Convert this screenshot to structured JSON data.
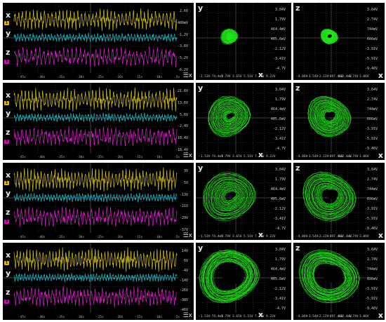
{
  "layout_rows": 4,
  "colors": {
    "x_trace": "#d8c400",
    "y_trace": "#1fb6c2",
    "z_trace": "#d11fc2",
    "phase": "#22e61a",
    "marker_x": "#e8b400",
    "marker_z": "#e000c8"
  },
  "rows": [
    {
      "time": {
        "labels": {
          "x": "x",
          "y": "y",
          "z": "z"
        },
        "ticks": [
          "-45s",
          "-40s",
          "-35s",
          "-30s",
          "-25s",
          "-20s",
          "-15s",
          "-10s",
          "-5s"
        ],
        "scale": [
          "2.6V",
          "400mV",
          "-1.2V",
          "-3.6V",
          "-5.2V",
          "-6.2V"
        ],
        "zoom": "☰x"
      },
      "xy": {
        "axis_x": "x",
        "axis_y": "y",
        "yticks": [
          "3.04V",
          "1.79V",
          "464.4mV",
          "405.6mV",
          "-2.12V",
          "-3.41V",
          "-4.7V"
        ],
        "xticks": [
          "-1.53V",
          "-74.4mV",
          "1.79V",
          "3.65V",
          "5.51V",
          "7.37V",
          "9.22V"
        ],
        "size": 0.12,
        "hole": 0.0
      },
      "xz": {
        "axis_x": "x",
        "axis_y": "z",
        "yticks": [
          "3.64V",
          "2.74V",
          "744mV",
          "606mV",
          "-3.91V",
          "-5.91V",
          "-9.46V"
        ],
        "xticks": [
          "-4.86V",
          "-3.54V",
          "-2.22V",
          "-897.4mV",
          "422.4mV",
          "1.74V",
          "3.06V"
        ],
        "size": 0.12,
        "hole": 0.25
      }
    },
    {
      "time": {
        "labels": {
          "x": "x",
          "y": "y",
          "z": "z"
        },
        "ticks": [
          "-45s",
          "-40s",
          "-35s",
          "-30s",
          "-25s",
          "-20s",
          "-15s",
          "-10s",
          "-5s"
        ],
        "scale": [
          "21.6V",
          "13.6V",
          "5.6V",
          "-2.4V",
          "-10.4V",
          "-18.4V"
        ],
        "zoom": "☰x"
      },
      "xy": {
        "axis_x": "x",
        "axis_y": "y",
        "yticks": [
          "3.04V",
          "1.79V",
          "464.4mV",
          "405.6mV",
          "-2.12V",
          "-3.41V",
          "-4.7V"
        ],
        "xticks": [
          "-1.53V",
          "-74.4mV",
          "1.79V",
          "3.65V",
          "5.51V",
          "7.37V",
          "9.22V"
        ],
        "size": 0.32,
        "hole": 0.15
      },
      "xz": {
        "axis_x": "x",
        "axis_y": "z",
        "yticks": [
          "3.64V",
          "2.74V",
          "744mV",
          "606mV",
          "-3.91V",
          "-5.91V",
          "-9.46V"
        ],
        "xticks": [
          "-4.86V",
          "-3.54V",
          "-2.22V",
          "-897.4mV",
          "422.4mV",
          "1.74V",
          "3.06V"
        ],
        "size": 0.32,
        "hole": 0.22
      }
    },
    {
      "time": {
        "labels": {
          "x": "x",
          "y": "y",
          "z": "z"
        },
        "ticks": [
          "-45s",
          "-40s",
          "-35s",
          "-30s",
          "-25s",
          "-20s",
          "-15s",
          "-10s",
          "-5s"
        ],
        "scale": [
          "3V",
          "-5V",
          "-13V",
          "-21V",
          "-29V",
          "-37V"
        ],
        "zoom": "☰x"
      },
      "xy": {
        "axis_x": "x",
        "axis_y": "y",
        "yticks": [
          "3.04V",
          "1.79V",
          "464.4mV",
          "405.6mV",
          "-2.12V",
          "-3.41V",
          "-4.7V"
        ],
        "xticks": [
          "-1.53V",
          "-74.4mV",
          "1.79V",
          "3.65V",
          "5.51V",
          "7.37V",
          "9.22V"
        ],
        "size": 0.38,
        "hole": 0.18
      },
      "xz": {
        "axis_x": "x",
        "axis_y": "z",
        "yticks": [
          "3.64V",
          "2.74V",
          "744mV",
          "606mV",
          "-3.91V",
          "-5.91V",
          "-9.46V"
        ],
        "xticks": [
          "-4.86V",
          "-3.54V",
          "-2.22V",
          "-897.4mV",
          "422.4mV",
          "1.74V",
          "3.06V"
        ],
        "size": 0.38,
        "hole": 0.3
      }
    },
    {
      "time": {
        "labels": {
          "x": "x",
          "y": "y",
          "z": "z"
        },
        "ticks": [
          "-45s",
          "-40s",
          "-35s",
          "-30s",
          "-25s",
          "-20s",
          "-15s",
          "-10s",
          "-5s"
        ],
        "scale": [
          "14V",
          "6V",
          "-4V",
          "-14V",
          "-26V",
          "-38V",
          "-46V"
        ],
        "zoom": "☰x"
      },
      "xy": {
        "axis_x": "x",
        "axis_y": "y",
        "yticks": [
          "3.04V",
          "1.79V",
          "464.4mV",
          "405.6mV",
          "-2.12V",
          "-3.41V",
          "-4.7V"
        ],
        "xticks": [
          "-1.53V",
          "-74.4mV",
          "1.79V",
          "3.65V",
          "5.51V",
          "7.37V",
          "9.22V"
        ],
        "size": 0.42,
        "hole": 0.55
      },
      "xz": {
        "axis_x": "x",
        "axis_y": "z",
        "yticks": [
          "3.64V",
          "2.74V",
          "744mV",
          "606mV",
          "-3.91V",
          "-5.91V",
          "-9.46V"
        ],
        "xticks": [
          "-4.86V",
          "-3.54V",
          "-2.22V",
          "-897.4mV",
          "422.4mV",
          "1.74V",
          "3.06V"
        ],
        "size": 0.42,
        "hole": 0.5
      }
    }
  ]
}
